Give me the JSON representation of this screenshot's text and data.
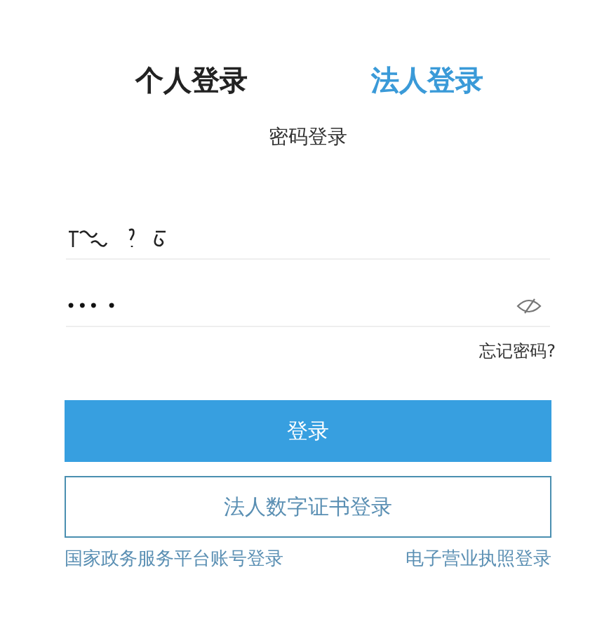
{
  "tabs": [
    {
      "label": "个人登录",
      "selected": false
    },
    {
      "label": "法人登录",
      "selected": true
    }
  ],
  "login_method": "密码登录",
  "username_field": {
    "kind": "masked"
  },
  "password_field": {
    "value": "••• •",
    "visible": false
  },
  "forgot_password": "忘记密码?",
  "login_button": "登录",
  "cert_login_button": "法人数字证书登录",
  "links": [
    "国家政务服务平台账号登录",
    "电子营业执照登录"
  ]
}
